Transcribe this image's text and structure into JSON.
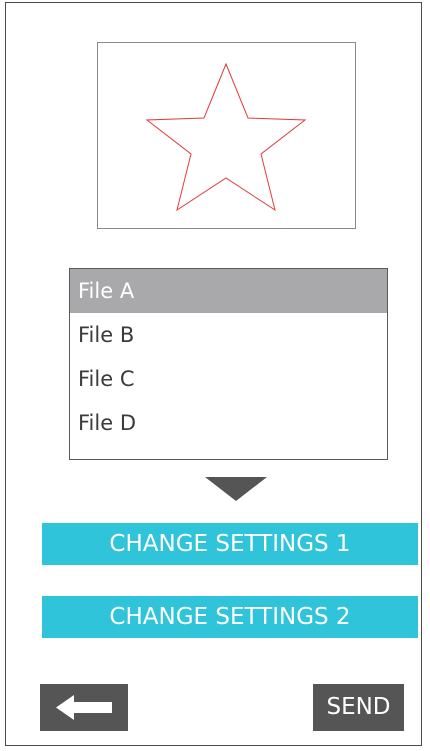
{
  "preview": {
    "icon": "star-outline",
    "stroke_color": "#e23b3b"
  },
  "file_list": {
    "items": [
      {
        "label": "File A",
        "selected": true
      },
      {
        "label": "File B",
        "selected": false
      },
      {
        "label": "File C",
        "selected": false
      },
      {
        "label": "File D",
        "selected": false
      }
    ]
  },
  "arrow": {
    "icon": "triangle-down-icon"
  },
  "actions": {
    "change_settings_1": "CHANGE SETTINGS 1",
    "change_settings_2": "CHANGE SETTINGS 2"
  },
  "footer": {
    "back_icon": "arrow-left-icon",
    "send_label": "SEND"
  },
  "colors": {
    "accent": "#2fc4d9",
    "dark_button": "#555556",
    "selected_row": "#a9a9ab",
    "star_stroke": "#e23b3b"
  }
}
